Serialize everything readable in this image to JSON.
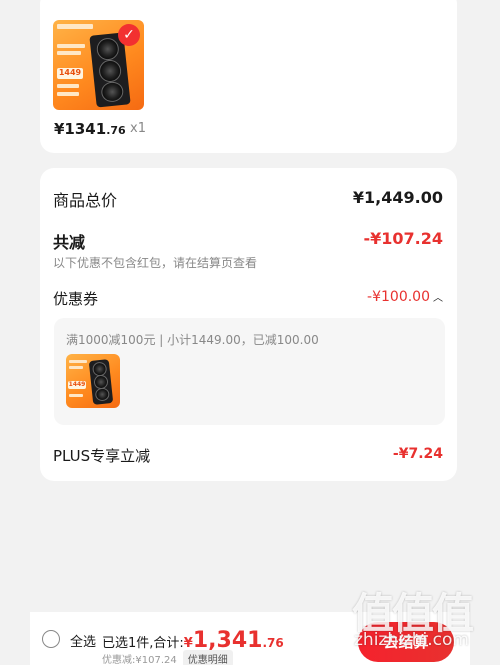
{
  "product": {
    "image_text": "1449",
    "price_main": "¥1341",
    "price_decimal": ".76",
    "quantity": "x1"
  },
  "summary": {
    "total_label": "商品总价",
    "total_value": "¥1,449.00",
    "reduced_label": "共减",
    "reduced_value": "-¥107.24",
    "reduced_note": "以下优惠不包含红包，请在结算页查看",
    "coupon_label": "优惠券",
    "coupon_value": "-¥100.00",
    "coupon_detail": "满1000减100元 | 小计1449.00，已减100.00",
    "plus_label": "PLUS专享立减",
    "plus_value": "-¥7.24"
  },
  "footer": {
    "select_all": "全选",
    "selected_prefix": "已选1件,合计:",
    "total_yen": "¥",
    "total_integer": "1,341",
    "total_decimal": ".76",
    "discount_line": "优惠减:¥107.24",
    "discount_detail": "优惠明细",
    "checkout_label": "去结算"
  },
  "watermark": {
    "glyphs": "值值值",
    "url": "zhizhizhi.com"
  },
  "colors": {
    "accent_red": "#e8312f",
    "product_orange": "#ff8a1f"
  }
}
